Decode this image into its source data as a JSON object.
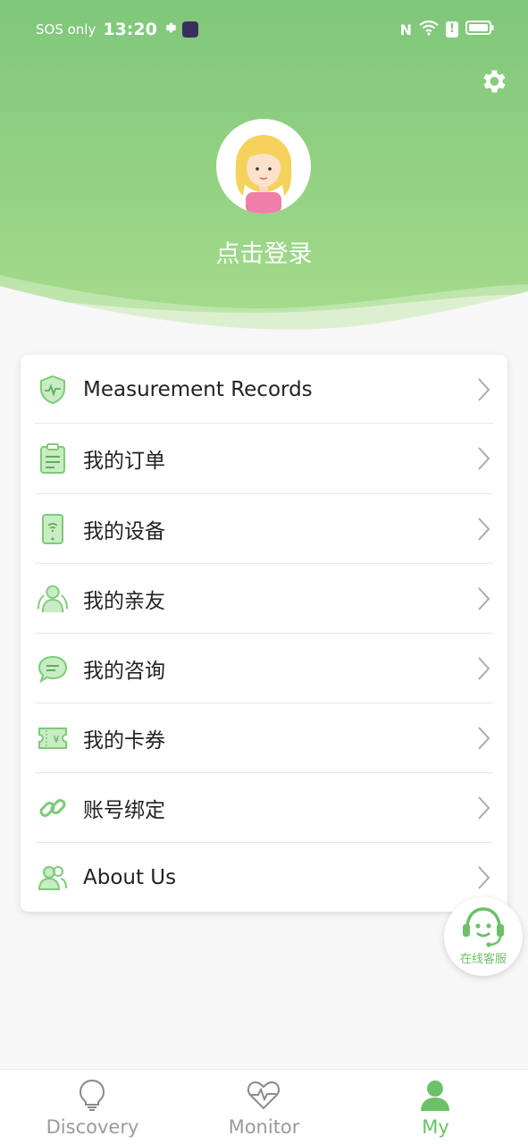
{
  "status_bar": {
    "network": "SOS only",
    "time": "13:20"
  },
  "header": {
    "login_prompt": "点击登录"
  },
  "menu": {
    "items": [
      {
        "label": "Measurement Records",
        "icon": "shield-pulse-icon"
      },
      {
        "label": "我的订单",
        "icon": "clipboard-icon"
      },
      {
        "label": "我的设备",
        "icon": "phone-device-icon"
      },
      {
        "label": "我的亲友",
        "icon": "people-group-icon"
      },
      {
        "label": "我的咨询",
        "icon": "chat-bubble-icon"
      },
      {
        "label": "我的卡券",
        "icon": "coupon-ticket-icon"
      },
      {
        "label": "账号绑定",
        "icon": "link-icon"
      },
      {
        "label": "About Us",
        "icon": "users-icon"
      }
    ]
  },
  "service": {
    "label": "在线客服"
  },
  "tabbar": {
    "tabs": [
      {
        "label": "Discovery",
        "icon": "lightbulb-icon",
        "active": false
      },
      {
        "label": "Monitor",
        "icon": "heart-pulse-icon",
        "active": false
      },
      {
        "label": "My",
        "icon": "person-icon",
        "active": true
      }
    ]
  },
  "colors": {
    "accent": "#6cc167",
    "header_top": "#7fc77a",
    "header_bottom": "#a8dc8e",
    "icon_green": "#7ccb77"
  }
}
